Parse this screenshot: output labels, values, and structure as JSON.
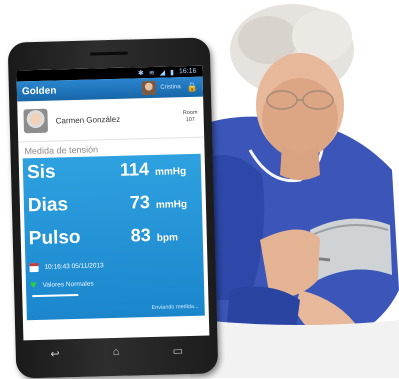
{
  "status_bar": {
    "time": "16:16",
    "icons": [
      "bluetooth-icon",
      "wifi-icon",
      "signal-icon",
      "battery-icon"
    ]
  },
  "app_bar": {
    "title": "Golden",
    "user_name": "Cristina",
    "lock_glyph": "🔒"
  },
  "patient": {
    "name": "Carmen González",
    "room_label": "Room",
    "room_number": "107"
  },
  "section_title": "Medida de tensión",
  "readings": [
    {
      "label": "Sis",
      "value": "114",
      "unit": "mmHg"
    },
    {
      "label": "Dias",
      "value": "73",
      "unit": "mmHg"
    },
    {
      "label": "Pulso",
      "value": "83",
      "unit": "bpm"
    }
  ],
  "timestamp": "10:16:43 05/11/2013",
  "status_text": "Valores Normales",
  "sending_text": "Enviando medida...",
  "nav": {
    "back": "↩",
    "home": "⌂",
    "recent": "▭"
  },
  "colors": {
    "accent": "#1b86cc",
    "app_bar": "#1766a8",
    "ok": "#2ecc40"
  }
}
